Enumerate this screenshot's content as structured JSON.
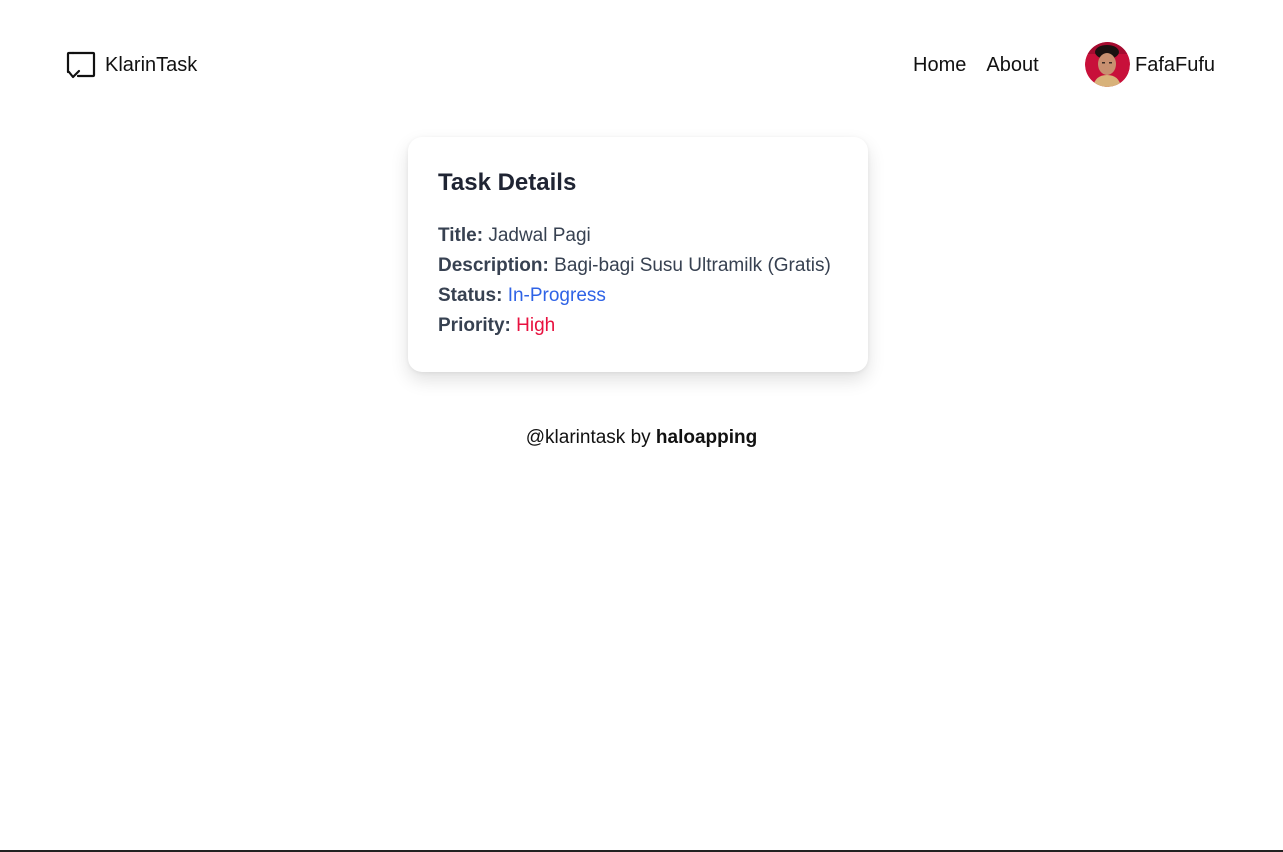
{
  "header": {
    "brand_name": "KlarinTask",
    "nav": [
      {
        "label": "Home"
      },
      {
        "label": "About"
      }
    ],
    "user": {
      "name": "FafaFufu"
    }
  },
  "task": {
    "heading": "Task Details",
    "title_label": "Title:",
    "title_value": "Jadwal Pagi",
    "description_label": "Description:",
    "description_value": "Bagi-bagi Susu Ultramilk (Gratis)",
    "status_label": "Status:",
    "status_value": "In-Progress",
    "priority_label": "Priority:",
    "priority_value": "High"
  },
  "footer": {
    "prefix": "@klarintask by",
    "author": "haloapping"
  },
  "colors": {
    "status": "#2f63e6",
    "priority": "#e8113f",
    "heading": "#1f2433",
    "body_text": "#374151"
  }
}
